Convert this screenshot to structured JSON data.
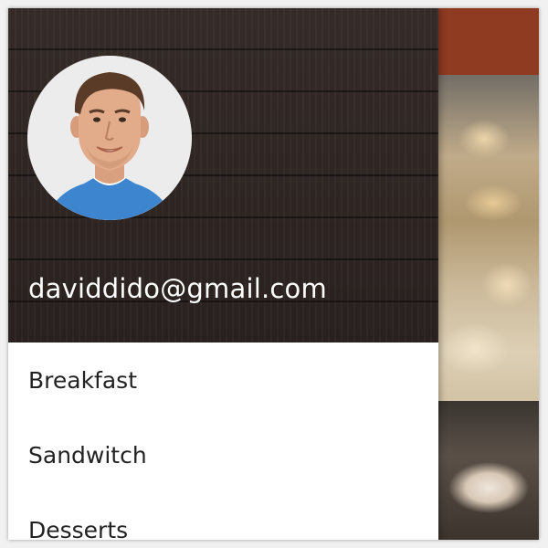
{
  "drawer": {
    "account": {
      "email": "daviddido@gmail.com",
      "avatar_icon": "profile-photo"
    },
    "menu_items": [
      {
        "label": "Breakfast"
      },
      {
        "label": "Sandwitch"
      },
      {
        "label": "Desserts"
      }
    ]
  },
  "colors": {
    "header_bg": "#2e2523",
    "app_bar": "#8e3b22",
    "menu_text": "#222222",
    "email_text": "#ffffff"
  }
}
